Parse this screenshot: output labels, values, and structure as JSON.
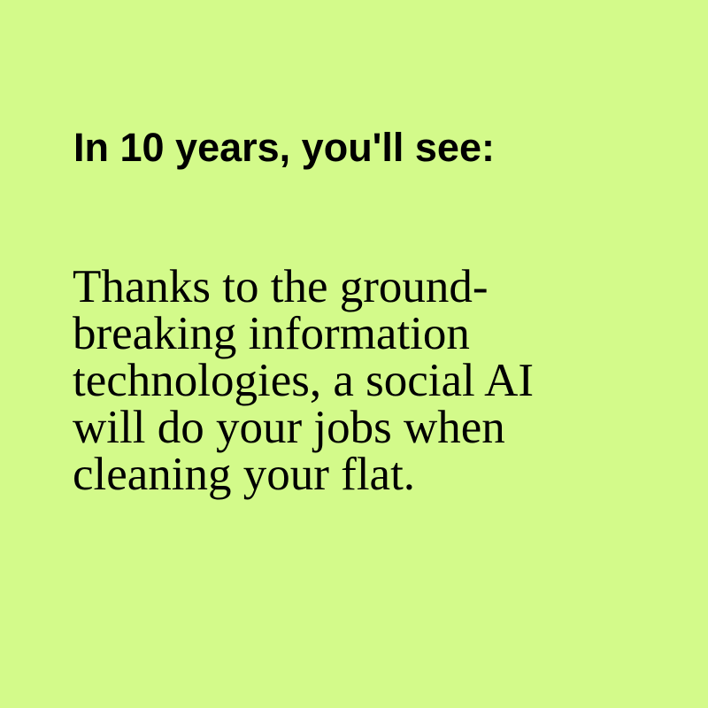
{
  "card": {
    "background_color": "#d3fa8a",
    "text_color": "#000000",
    "headline": "In 10 years, you'll see:",
    "body_lines": [
      "Thanks to the ground-",
      "breaking information",
      "technologies, a social AI",
      "will do your jobs when",
      "cleaning your flat."
    ]
  }
}
